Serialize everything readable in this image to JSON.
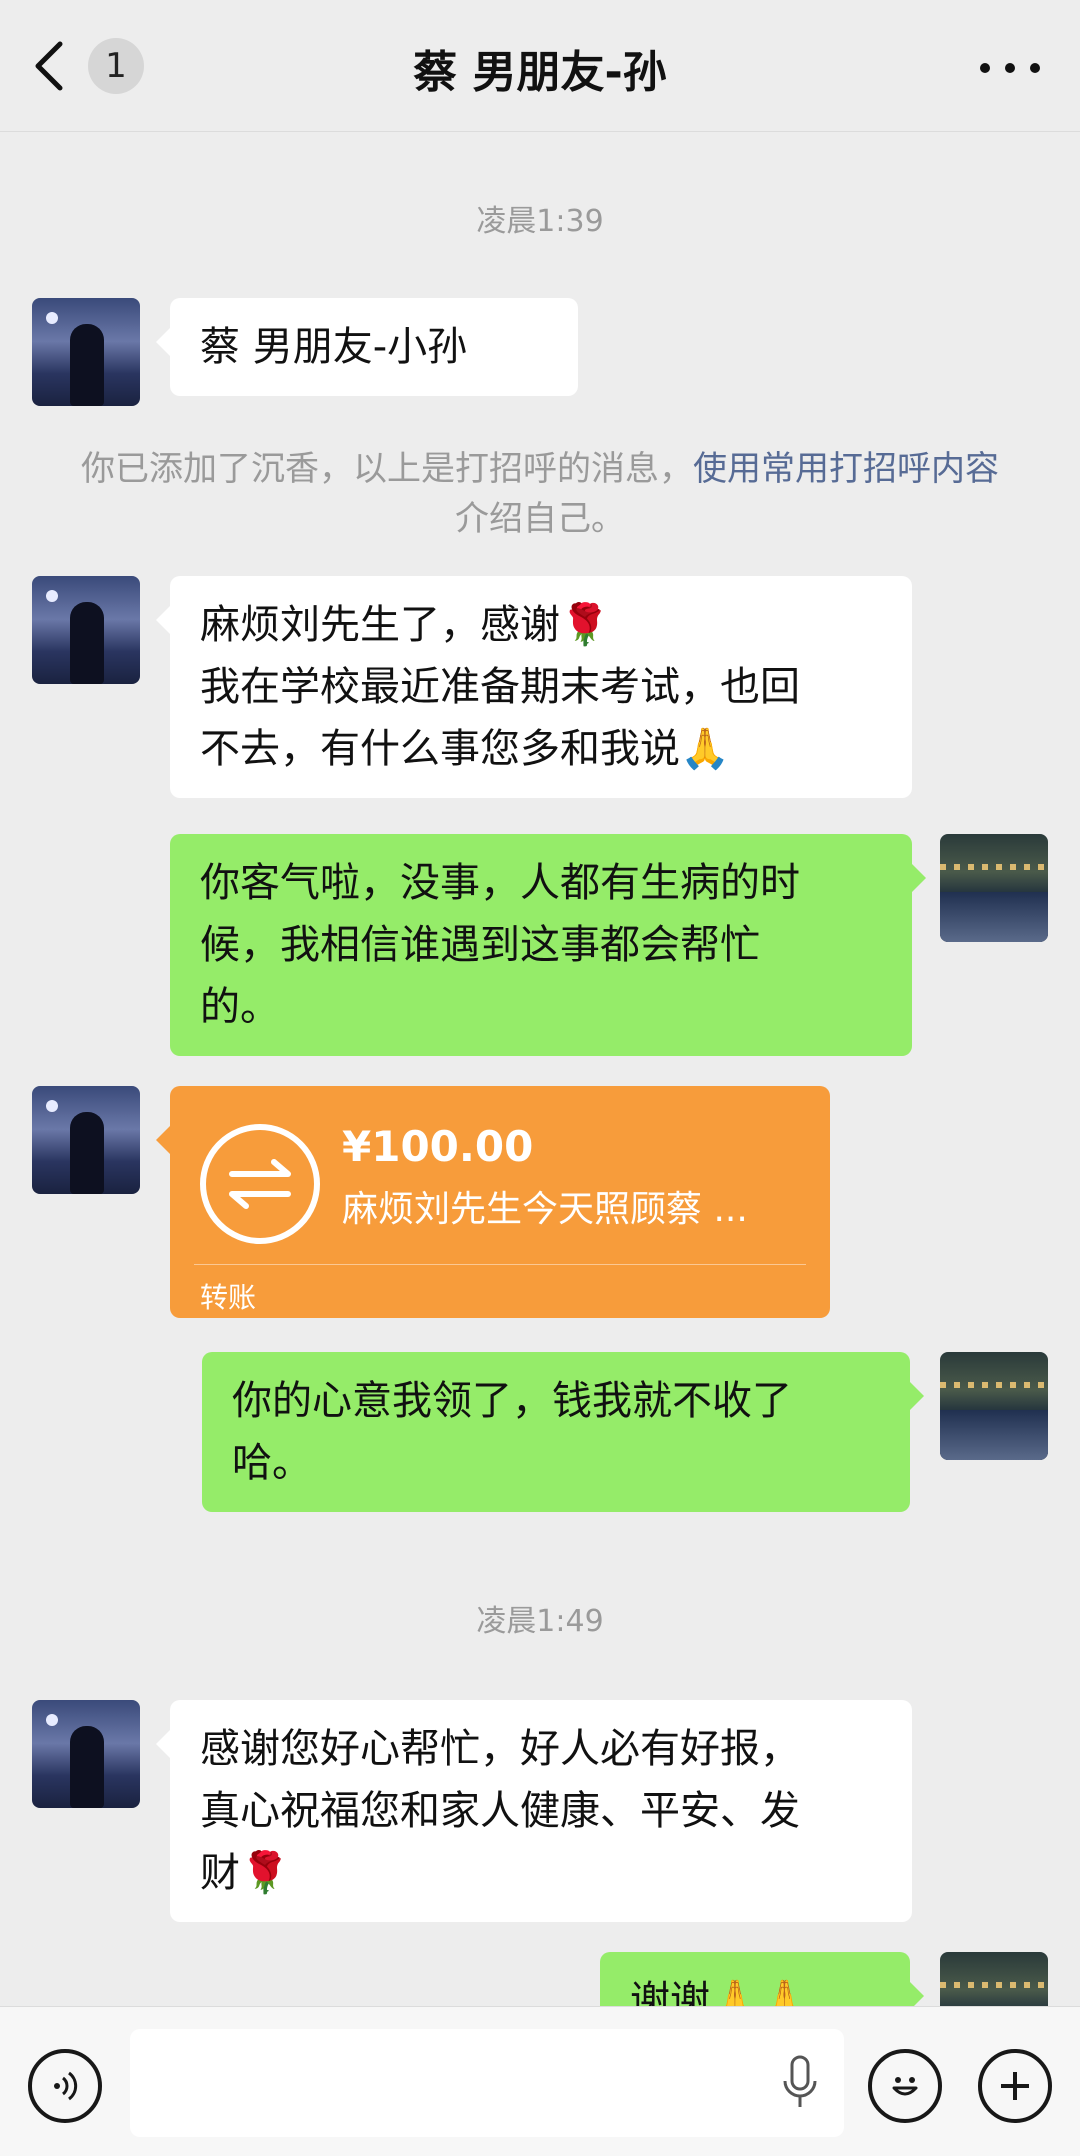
{
  "header": {
    "back_count": "1",
    "title": "蔡 男朋友-孙"
  },
  "chat": {
    "time1": "凌晨1:39",
    "msg1": "蔡 男朋友-小孙",
    "system_notice": {
      "text": "你已添加了沉香，以上是打招呼的消息，",
      "link": "使用常用打招呼内容",
      "suffix": "介绍自己。"
    },
    "msg2_line1": "麻烦刘先生了，感谢🌹",
    "msg2_line2": "我在学校最近准备期末考试，也回",
    "msg2_line3": "不去，有什么事您多和我说🙏",
    "msg3_line1": "你客气啦，没事，人都有生病的时",
    "msg3_line2": "候，我相信谁遇到这事都会帮忙",
    "msg3_line3": "的。",
    "transfer": {
      "amount": "¥100.00",
      "note": "麻烦刘先生今天照顾蔡 ...",
      "label": "转账"
    },
    "msg4_line1": "你的心意我领了，钱我就不收了",
    "msg4_line2": "哈。",
    "time2": "凌晨1:49",
    "msg5_line1": "感谢您好心帮忙，好人必有好报，",
    "msg5_line2": "真心祝福您和家人健康、平安、发",
    "msg5_line3": "财🌹",
    "msg6": "谢谢🙏🙏"
  },
  "input": {
    "voice_icon": "voice-icon",
    "emoji_icon": "emoji-icon",
    "plus_icon": "plus-icon"
  }
}
